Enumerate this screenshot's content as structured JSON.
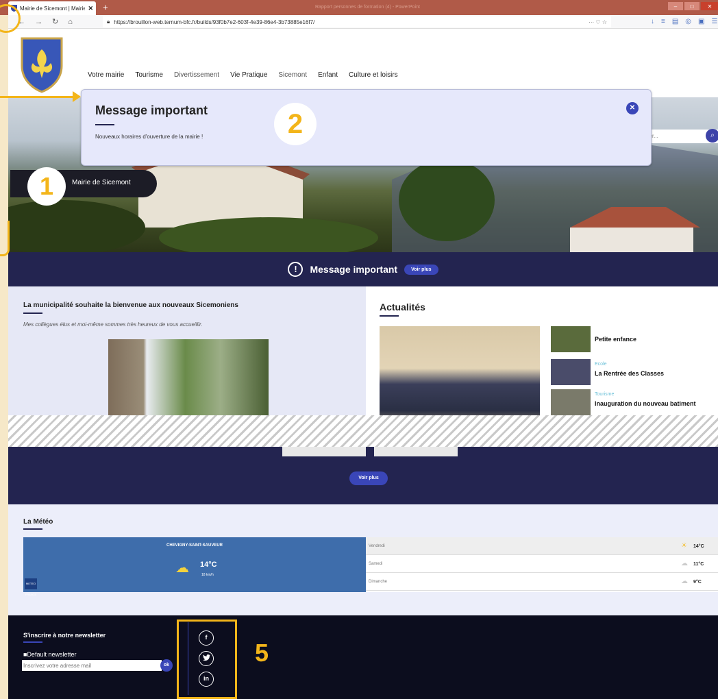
{
  "browser": {
    "tab_title": "Mairie de Sicemont | Mairie de",
    "tab_close": "✕",
    "new_tab": "+",
    "window_title": "Rapport personnes de formation (4) - PowerPoint",
    "url": "https://brouillon-web.ternum-bfc.fr/builds/93f0b7e2-603f-4e39-86e4-3b73885e16f7/",
    "url_right": "··· ♡ ☆"
  },
  "nav": {
    "items": [
      "Votre mairie",
      "Tourisme",
      "Divertissement",
      "Vie Pratique",
      "Sicemont",
      "Enfant",
      "Culture et loisirs"
    ]
  },
  "search": {
    "placeholder": "her..."
  },
  "hero": {
    "pill_label": "Mairie de Sicemont"
  },
  "modal": {
    "title": "Message important",
    "text": "Nouveaux horaires d'ouverture de la mairie !",
    "close": "✕"
  },
  "banner": {
    "icon": "!",
    "title": "Message important",
    "button": "Voir plus"
  },
  "welcome": {
    "title": "La municipalité souhaite la bienvenue aux nouveaux Sicemoniens",
    "subtitle": "Mes collègues élus et moi-même sommes très heureux de vous accueillir."
  },
  "actualites": {
    "title": "Actualités",
    "items": [
      {
        "category": "",
        "title": "Petite enfance"
      },
      {
        "category": "Ecole",
        "title": "La Rentrée des Classes"
      },
      {
        "category": "Tourisme",
        "title": "Inauguration du nouveau batiment"
      }
    ]
  },
  "section2": {
    "button": "Voir plus"
  },
  "meteo": {
    "title": "La Météo",
    "city": "CHEVIGNY-SAINT-SAUVEUR",
    "temp": "14°C",
    "wind": "18 km/h",
    "logo": "METEO FRANCE",
    "days": [
      {
        "day": "Vendredi",
        "temp": "14°C"
      },
      {
        "day": "Samedi",
        "temp": "11°C"
      },
      {
        "day": "Dimanche",
        "temp": "9°C"
      }
    ]
  },
  "newsletter": {
    "title": "S'inscrire à notre newsletter",
    "checkbox_label": "Default newsletter",
    "placeholder": "Inscrivez votre adresse mail",
    "ok": "ok"
  },
  "social": [
    "f",
    "t",
    "in"
  ],
  "annotations": {
    "one": "1",
    "two": "2",
    "five": "5"
  },
  "colors": {
    "navy": "#232450",
    "accent": "#3a46b8",
    "highlight": "#f3b51a",
    "meteo_blue": "#3e6dab"
  }
}
